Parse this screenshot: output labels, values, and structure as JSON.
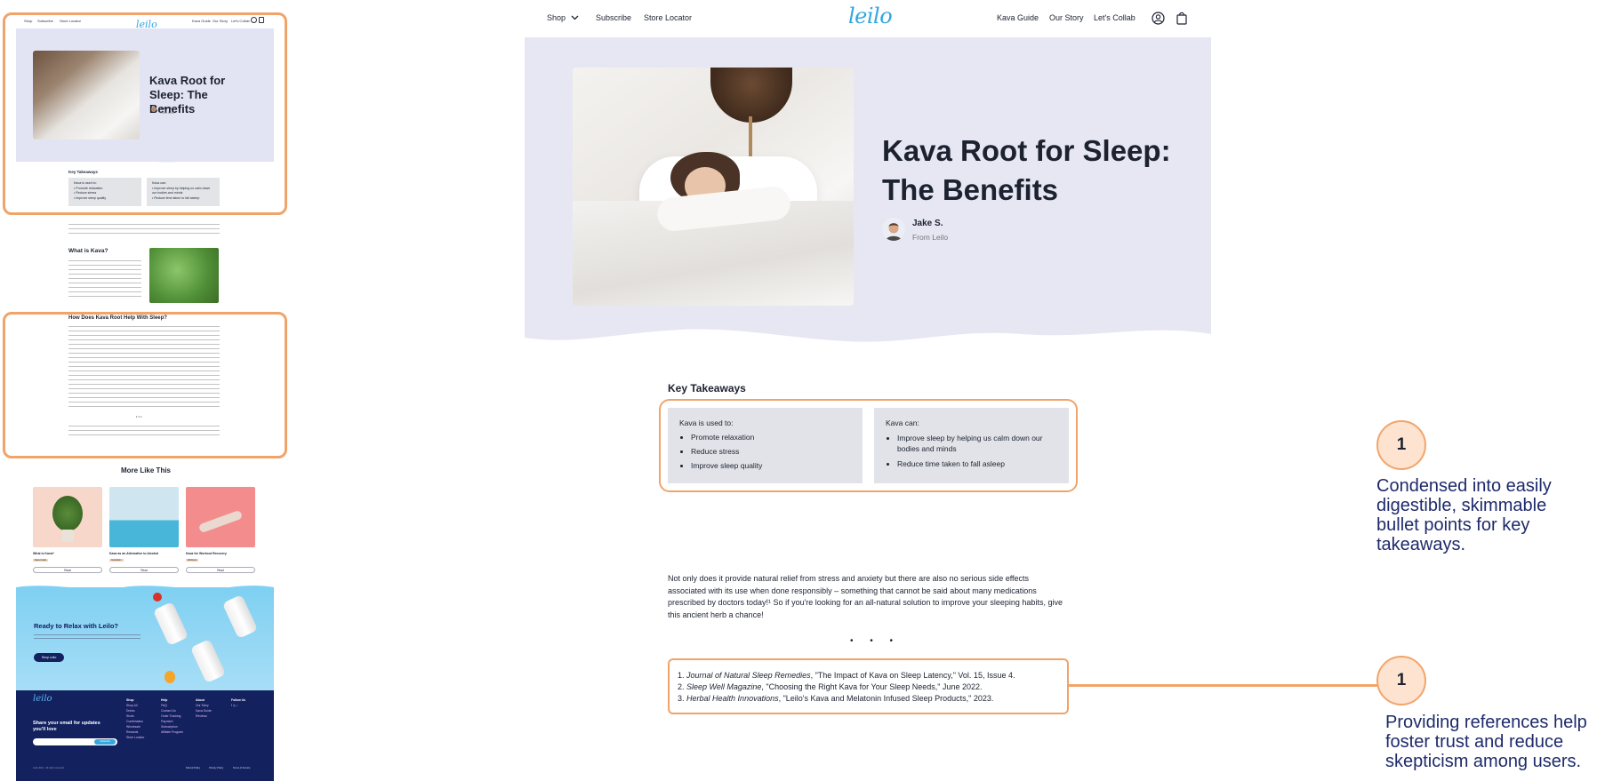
{
  "thumbnail": {
    "nav": {
      "shop": "Shop",
      "subscribe": "Subscribe",
      "store_locator": "Store Locator",
      "logo": "leilo",
      "kava_guide": "Kava Guide",
      "our_story": "Our Story",
      "collab": "Let's Collab"
    },
    "hero_title": "Kava Root for Sleep: The Benefits",
    "author_name": "Jake S.",
    "author_from": "From Leilo",
    "key_takeaways": "Key Takeaways",
    "used_title": "Kava is used to:",
    "used_items": [
      "Promote relaxation",
      "Reduce stress",
      "Improve sleep quality"
    ],
    "can_title": "Kava can:",
    "can_items": [
      "Improve sleep by helping us calm down our bodies and minds",
      "Reduce time taken to fall asleep"
    ],
    "what_is_kava": "What is Kava?",
    "how_does": "How Does Kava Root Help With Sleep?",
    "more_like_this": "More Like This",
    "cards": [
      {
        "title": "What is Kava?",
        "tag": "Kava Guide",
        "button": "Read"
      },
      {
        "title": "Kava as an Alternative to Alcohol",
        "tag": "Inspiration",
        "button": "Read"
      },
      {
        "title": "Kava for Workout Recovery",
        "tag": "Wellness",
        "button": "Read"
      }
    ],
    "cta_title": "Ready to Relax with Leilo?",
    "cta_button": "Shop Leilo",
    "footer_logo": "leilo",
    "footer_heading": "Share your email for updates you'll love",
    "footer_subscribe": "Subscribe",
    "footer_cols": [
      {
        "title": "Shop",
        "items": [
          "Shop All",
          "Drinks",
          "Shots",
          "Combination",
          "Wholesale",
          "Rewards",
          "Store Locator"
        ]
      },
      {
        "title": "Help",
        "items": [
          "FAQ",
          "Contact Us",
          "Order Tracking",
          "Payment",
          "Subscription",
          "Affiliate Program"
        ]
      },
      {
        "title": "About",
        "items": [
          "Our Story",
          "Kava Guide",
          "Reviews"
        ]
      },
      {
        "title": "Follow Us",
        "items": []
      }
    ],
    "footer_copy": "Leilo 2024 · All rights reserved",
    "footer_legal": [
      "Refund Policy",
      "Privacy Policy",
      "Terms of Service"
    ]
  },
  "nav": {
    "shop": "Shop",
    "subscribe": "Subscribe",
    "store_locator": "Store Locator",
    "logo": "leilo",
    "kava_guide": "Kava Guide",
    "our_story": "Our Story",
    "collab": "Let's Collab"
  },
  "hero": {
    "title_line1": "Kava Root for Sleep:",
    "title_line2": "The Benefits",
    "author_name": "Jake S.",
    "author_from": "From Leilo"
  },
  "key_takeaways": {
    "title": "Key Takeaways",
    "used_title": "Kava is used to:",
    "used_items": [
      "Promote relaxation",
      "Reduce stress",
      "Improve sleep quality"
    ],
    "can_title": "Kava can:",
    "can_items": [
      "Improve sleep by helping us calm down our bodies and minds",
      "Reduce time taken to fall asleep"
    ]
  },
  "body_paragraph": "Not only does it provide natural relief from stress and anxiety but there are also no serious side effects associated with its use when done responsibly – something that cannot be said about many medications prescribed by doctors today!¹ So if you're looking for an all-natural solution to improve your sleeping habits, give this ancient herb a chance!",
  "separator": "• • •",
  "references": [
    {
      "num": "1.",
      "source": "Journal of Natural Sleep Remedies",
      "rest": ", \"The Impact of Kava on Sleep Latency,\" Vol. 15, Issue 4."
    },
    {
      "num": "2.",
      "source": "Sleep Well Magazine",
      "rest": ", \"Choosing the Right Kava for Your Sleep Needs,\" June 2022."
    },
    {
      "num": "3.",
      "source": "Herbal Health Innovations",
      "rest": ", \"Leilo's Kava and Melatonin Infused Sleep Products,\" 2023."
    }
  ],
  "annotations": [
    {
      "number": "1",
      "text": "Condensed into easily digestible, skimmable bullet points for key takeaways."
    },
    {
      "number": "1",
      "text": "Providing references help foster trust and reduce skepticism among users."
    }
  ],
  "colors": {
    "accent_orange": "#f2a56b",
    "brand_blue": "#2fa7e0",
    "navy": "#13215f",
    "hero_bg": "#e6e7f3"
  }
}
